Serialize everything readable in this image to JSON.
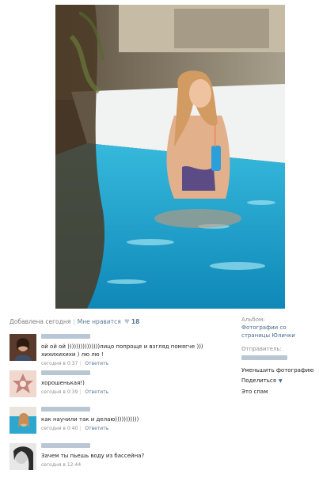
{
  "photo": {
    "alt_icon": "photo-of-woman-in-pool"
  },
  "meta": {
    "added": "Добавлена сегодня",
    "like_label": "Мне нравится",
    "like_count": "18"
  },
  "comments": [
    {
      "text": "ой ой ой )))))))))))))))лицо попроще и взгляд помягче ))) хихихихихи ) лю лю !",
      "time": "сегодня в 0:37",
      "reply": "Ответить"
    },
    {
      "text": "хорошенькая!)",
      "time": "сегодня в 0:39",
      "reply": "Ответить"
    },
    {
      "text": "как научили так и делаю)))))))))))",
      "time": "сегодня в 0:40",
      "reply": "Ответить"
    },
    {
      "text": "Зачем ты пьешь воду из бассейна?",
      "time": "сегодня в 12:44",
      "reply": ""
    }
  ],
  "side": {
    "album_label": "Альбом:",
    "album_link": "Фотографии со страницы Юлички",
    "sender_label": "Отправитель:",
    "reduce": "Уменьшить фотографию",
    "share": "Поделиться",
    "spam": "Это спам"
  },
  "colors": {
    "link": "#45688e",
    "muted": "#8f8f8f",
    "redaction": "#b9c6d4",
    "pool": "#1fa3c9"
  }
}
